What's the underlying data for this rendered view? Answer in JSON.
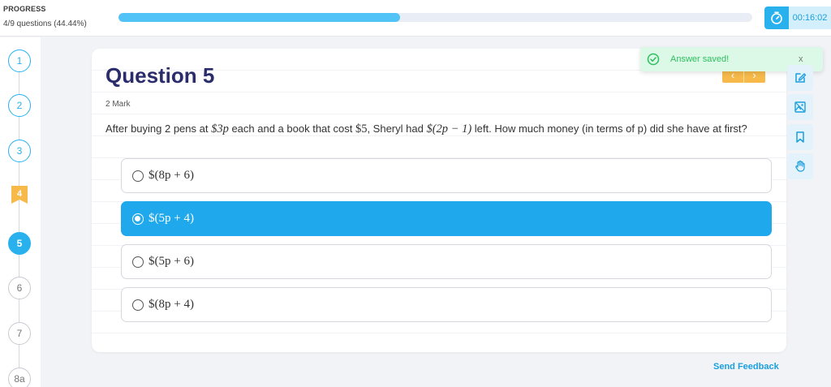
{
  "progress": {
    "title": "PROGRESS",
    "count_text": "4/9 questions (44.44%)",
    "fraction": 0.4444
  },
  "timer": {
    "icon": "stopwatch-icon",
    "time": "00:16:02"
  },
  "question_nav": [
    {
      "label": "1",
      "state": "answered"
    },
    {
      "label": "2",
      "state": "answered"
    },
    {
      "label": "3",
      "state": "answered"
    },
    {
      "label": "4",
      "state": "flagged"
    },
    {
      "label": "5",
      "state": "current"
    },
    {
      "label": "6",
      "state": "pending"
    },
    {
      "label": "7",
      "state": "pending"
    },
    {
      "label": "8a",
      "state": "pending"
    }
  ],
  "question": {
    "title": "Question 5",
    "mark": "2 Mark",
    "text_parts": {
      "p1": "After buying 2 pens at ",
      "m1": "$3p",
      "p2": " each and a book that cost ",
      "m2": "$5",
      "p3": ", Sheryl had ",
      "m3": "$(2p − 1)",
      "p4": " left. How much money (in terms of p) did she have at first?"
    },
    "options": [
      {
        "label": "$(8p + 6)",
        "selected": false
      },
      {
        "label": "$(5p + 4)",
        "selected": true
      },
      {
        "label": "$(5p + 6)",
        "selected": false
      },
      {
        "label": "$(8p + 4)",
        "selected": false
      }
    ]
  },
  "nav_arrows": {
    "prev": "‹",
    "next": "›"
  },
  "toast": {
    "icon": "check-circle-icon",
    "text": "Answer saved!",
    "close": "x"
  },
  "tools": [
    "edit-icon",
    "image-icon",
    "bookmark-icon",
    "hand-icon"
  ],
  "feedback_link": "Send Feedback",
  "colors": {
    "accent": "#29b1ee",
    "flag": "#f6b94a",
    "title": "#2b2c6b",
    "toast_bg": "#dcf8e6",
    "toast_text": "#2dbf5f"
  }
}
